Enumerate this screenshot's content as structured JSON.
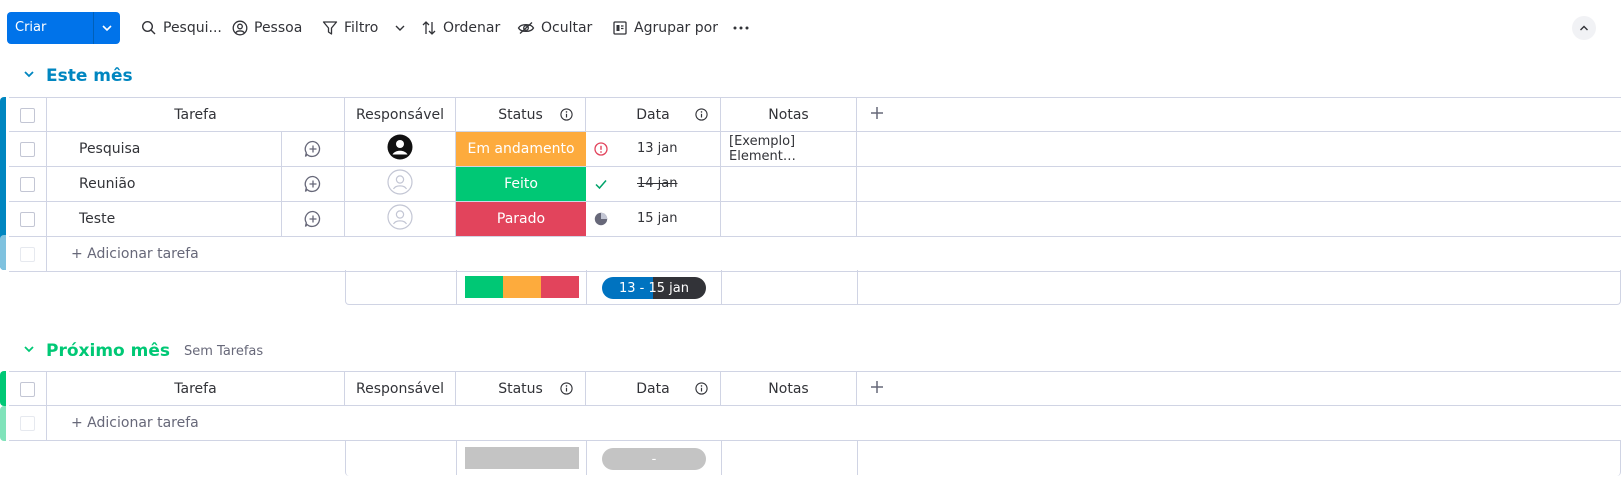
{
  "toolbar": {
    "create_label": "Criar tarefa",
    "search_label": "Pesqui...",
    "person_label": "Pessoa",
    "filter_label": "Filtro",
    "sort_label": "Ordenar",
    "hide_label": "Ocultar",
    "group_label": "Agrupar por"
  },
  "columns": {
    "task": "Tarefa",
    "owner": "Responsável",
    "status": "Status",
    "date": "Data",
    "notes": "Notas"
  },
  "groups": [
    {
      "title": "Este mês",
      "color": "#0086c0",
      "add_task": "+ Adicionar tarefa",
      "rows": [
        {
          "task": "Pesquisa",
          "owner": "filled",
          "status": "Em andamento",
          "status_color": "#fdab3d",
          "date_icon": "alert-icon",
          "date": "13 jan",
          "notes": "[Exemplo] Element…"
        },
        {
          "task": "Reunião",
          "owner": "empty",
          "status": "Feito",
          "status_color": "#00c875",
          "date_icon": "check-icon",
          "date": "14 jan",
          "notes": ""
        },
        {
          "task": "Teste",
          "owner": "empty",
          "status": "Parado",
          "status_color": "#e2445c",
          "date_icon": "clock-icon",
          "date": "15 jan",
          "notes": ""
        }
      ],
      "summary": {
        "status_distribution": [
          {
            "label": "Feito",
            "fraction": 0.333,
            "color": "#00c875"
          },
          {
            "label": "Em andamento",
            "fraction": 0.333,
            "color": "#fdab3d"
          },
          {
            "label": "Parado",
            "fraction": 0.334,
            "color": "#e2445c"
          }
        ],
        "date_range": "13 - 15 jan"
      }
    },
    {
      "title": "Próximo mês",
      "subtitle": "Sem Tarefas",
      "color": "#00c875",
      "add_task": "+ Adicionar tarefa",
      "summary": {
        "date_range": "-"
      }
    }
  ]
}
